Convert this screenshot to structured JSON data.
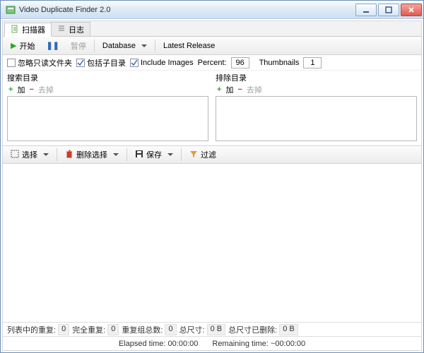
{
  "window": {
    "title": "Video Duplicate Finder 2.0"
  },
  "tabs": {
    "scanner": "扫描器",
    "log": "日志"
  },
  "toolbar": {
    "start": "开始",
    "pause": "暂停",
    "database": "Database",
    "latest": "Latest Release"
  },
  "options": {
    "ignore_readonly": "忽略只读文件夹",
    "include_sub": "包括子目录",
    "include_images": "Include Images",
    "percent_label": "Percent:",
    "percent_value": "96",
    "thumbs_label": "Thumbnails",
    "thumbs_value": "1"
  },
  "dirs": {
    "search_title": "搜索目录",
    "exclude_title": "排除目录",
    "add": "加",
    "remove": "去掉"
  },
  "toolbar2": {
    "select": "选择",
    "delete_select": "删除选择",
    "save": "保存",
    "filter": "过滤"
  },
  "status": {
    "dup_in_list_label": "列表中的重复:",
    "dup_in_list": "0",
    "full_dup_label": "完全重复:",
    "full_dup": "0",
    "group_count_label": "重复组总数:",
    "group_count": "0",
    "total_size_label": "总尺寸:",
    "total_size": "0 B",
    "deleted_size_label": "总尺寸已删除:",
    "deleted_size": "0 B",
    "elapsed_label": "Elapsed time:",
    "elapsed": "00:00:00",
    "remaining_label": "Remaining time:",
    "remaining": "~00:00:00"
  }
}
